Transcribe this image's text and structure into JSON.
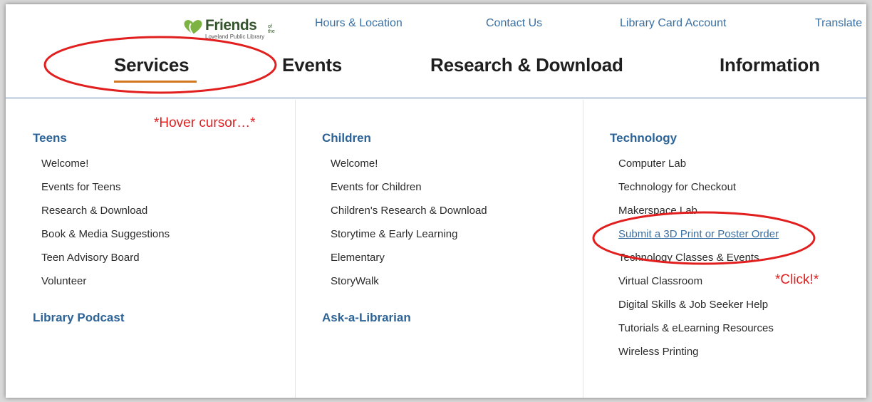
{
  "logo": {
    "name": "Friends",
    "of_the": "of the",
    "subtitle": "Loveland Public Library"
  },
  "utility_nav": [
    "Hours & Location",
    "Contact Us",
    "Library Card Account",
    "Translate"
  ],
  "main_nav": [
    "Services",
    "Events",
    "Research & Download",
    "Information"
  ],
  "menu": {
    "teens": {
      "heading": "Teens",
      "items": [
        "Welcome!",
        "Events for Teens",
        "Research & Download",
        "Book & Media Suggestions",
        "Teen Advisory Board",
        "Volunteer"
      ],
      "footer_heading": "Library Podcast"
    },
    "children": {
      "heading": "Children",
      "items": [
        "Welcome!",
        "Events for Children",
        "Children's Research & Download",
        "Storytime & Early Learning",
        "Elementary",
        "StoryWalk"
      ],
      "footer_heading": "Ask-a-Librarian"
    },
    "technology": {
      "heading": "Technology",
      "items": [
        "Computer Lab",
        "Technology for Checkout",
        "Makerspace Lab",
        "Submit a 3D Print or Poster Order",
        "Technology Classes & Events",
        "Virtual Classroom",
        "Digital Skills & Job Seeker Help",
        "Tutorials & eLearning Resources",
        "Wireless Printing"
      ]
    }
  },
  "annotations": {
    "hover": "*Hover cursor…*",
    "click": "*Click!*",
    "color": "#e21f1f"
  },
  "colors": {
    "heading": "#2d6498",
    "link": "#3a6fa2",
    "accent_underline": "#d4761e",
    "logo_green": "#34552b"
  }
}
